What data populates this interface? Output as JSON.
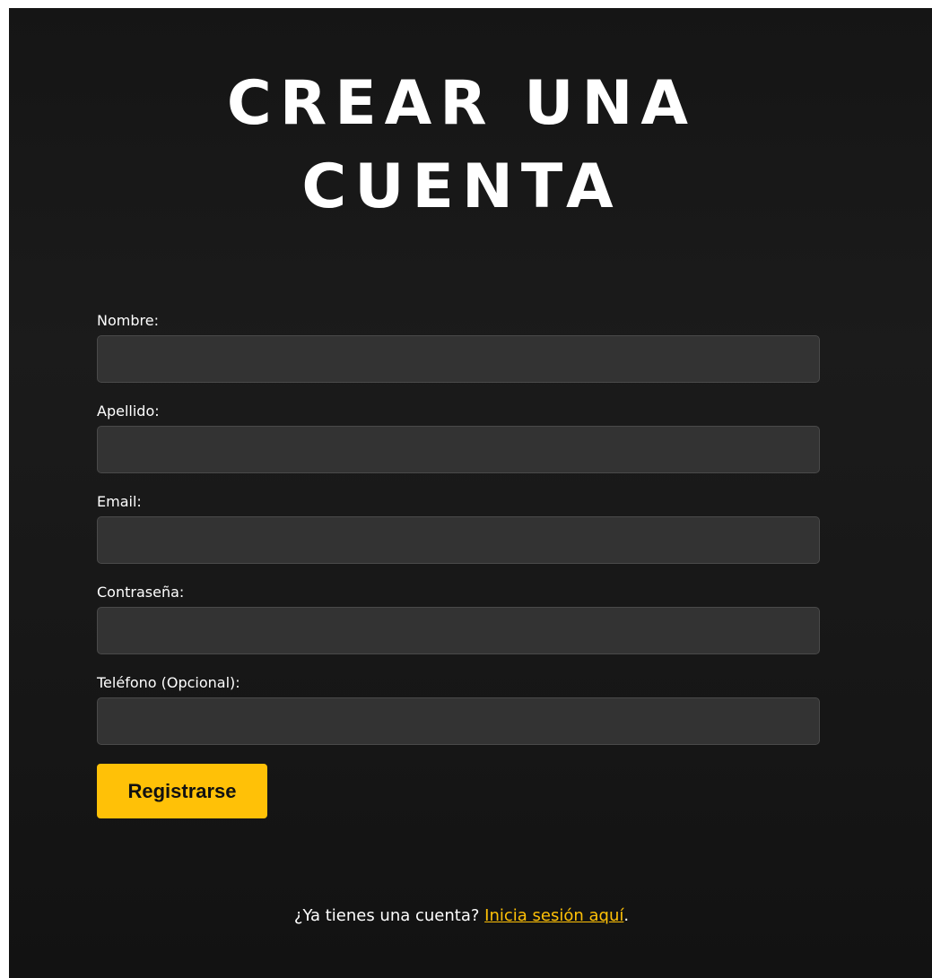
{
  "header": {
    "title_line1": "CREAR UNA",
    "title_line2": "CUENTA"
  },
  "form": {
    "fields": [
      {
        "label": "Nombre:",
        "value": ""
      },
      {
        "label": "Apellido:",
        "value": ""
      },
      {
        "label": "Email:",
        "value": ""
      },
      {
        "label": "Contraseña:",
        "value": ""
      },
      {
        "label": "Teléfono (Opcional):",
        "value": ""
      }
    ],
    "submit_label": "Registrarse"
  },
  "footer": {
    "prompt": "¿Ya tienes una cuenta? ",
    "link_label": "Inicia sesión aquí",
    "suffix": "."
  },
  "colors": {
    "accent": "#ffc107",
    "input_bg": "#333333",
    "page_bg": "#171717"
  }
}
